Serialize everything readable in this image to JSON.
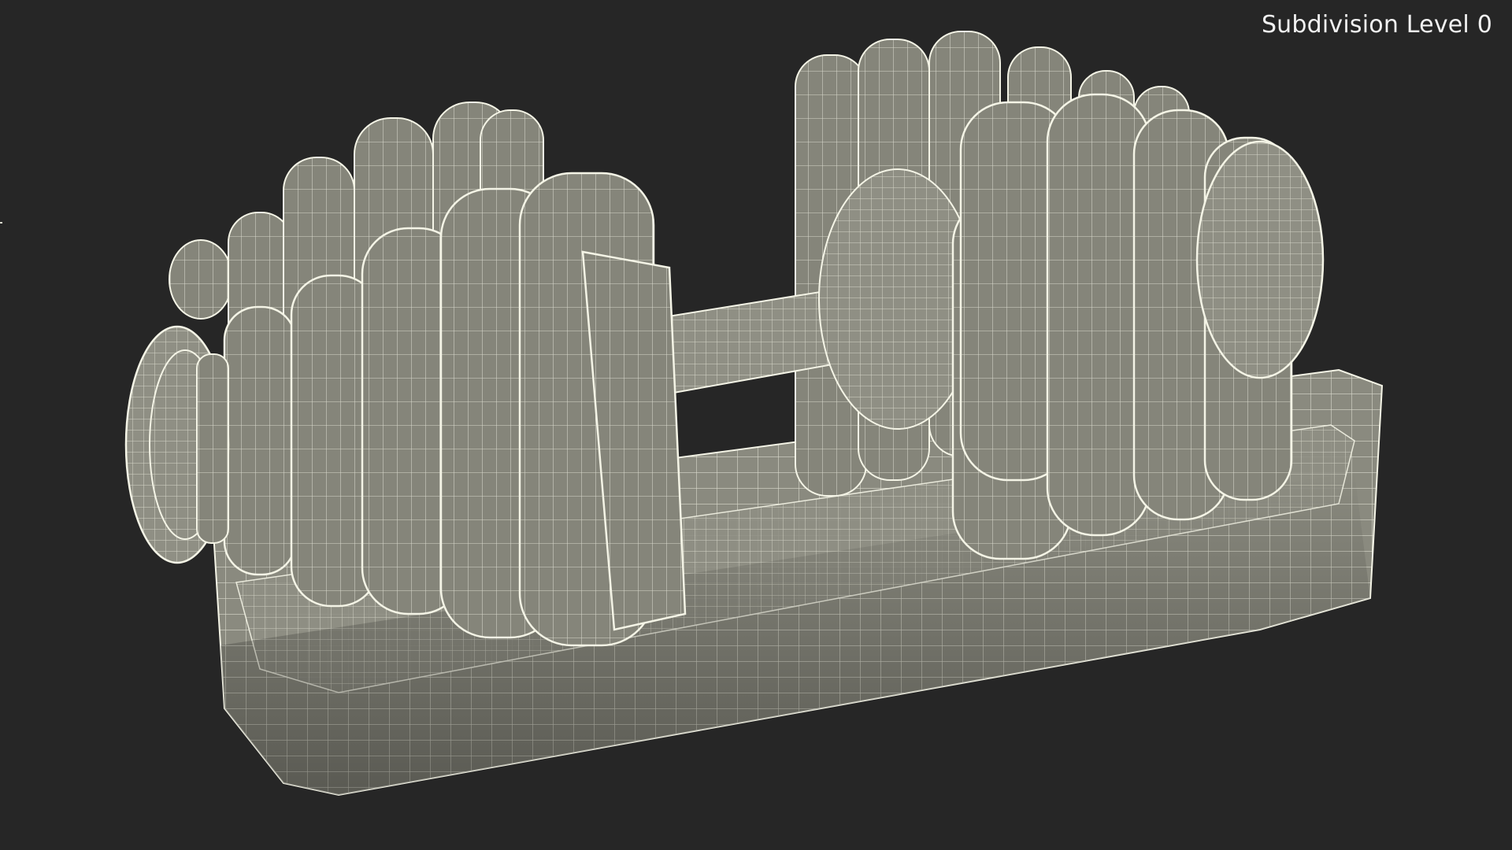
{
  "viewport": {
    "subdivision_label": "Subdivision Level 0",
    "background_color": "#262626",
    "model_fill_color": "#8a8a7f",
    "wire_color": "#f4f4e6"
  },
  "model": {
    "subject": "adjustable dumbbell in cradle",
    "display_mode": "wireframe on shaded"
  }
}
